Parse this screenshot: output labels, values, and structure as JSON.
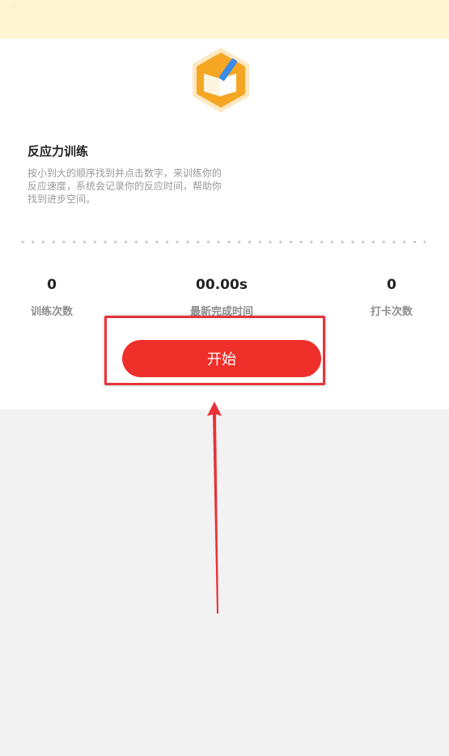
{
  "header": {
    "back_icon": "chevron-left-icon"
  },
  "card": {
    "logo_icon": "book-pencil-hexagon-icon",
    "title": "反应力训练",
    "description_lines": [
      "按小到大的顺序找到并点击数字，来训练你的",
      "反应速度，系统会记录你的反应时间，帮助你",
      "找到进步空间。"
    ]
  },
  "stats": [
    {
      "value": "0",
      "label": "训练次数"
    },
    {
      "value": "00.00s",
      "label": "最新完成时间"
    },
    {
      "value": "0",
      "label": "打卡次数"
    }
  ],
  "actions": {
    "start_label": "开始"
  },
  "colors": {
    "topbar": "#fff5d2",
    "accent": "#ef2f2a",
    "annotation": "#e8323a",
    "logo_orange": "#f5a623"
  }
}
